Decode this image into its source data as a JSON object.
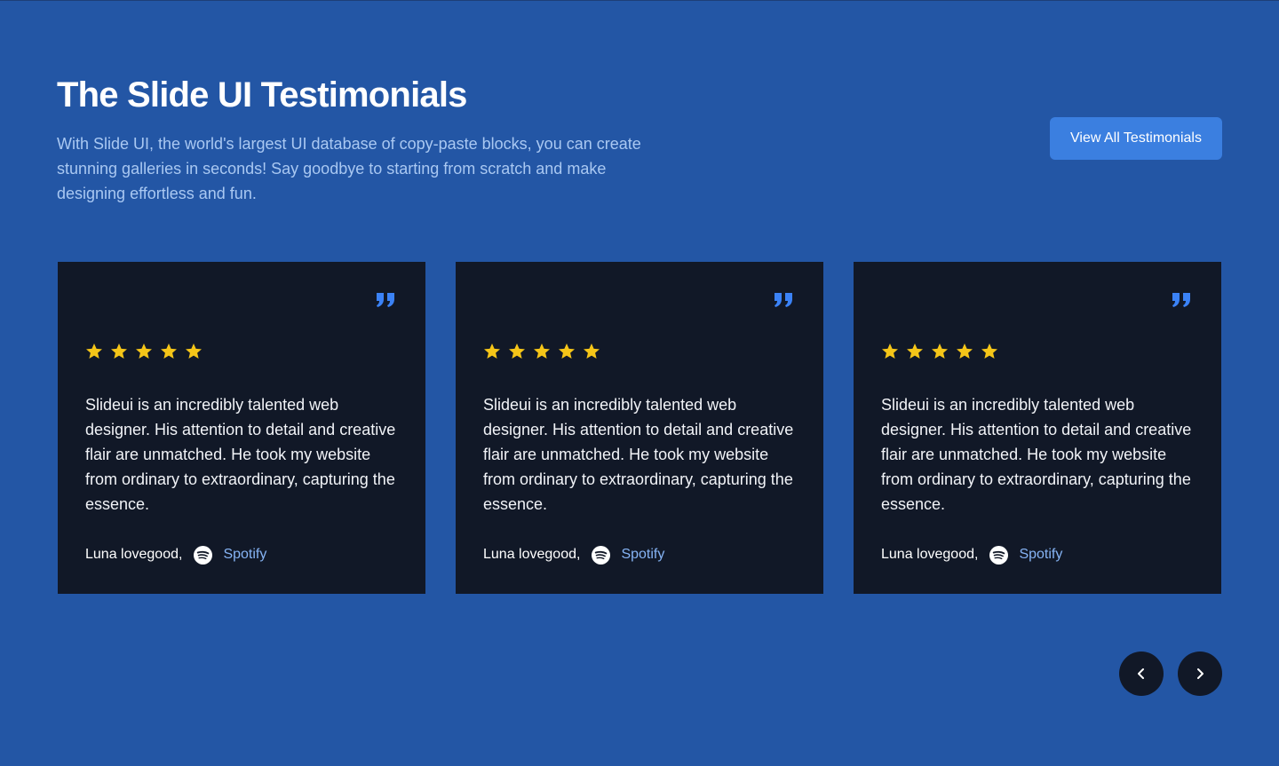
{
  "section": {
    "title": "The Slide UI Testimonials",
    "description": "With Slide UI, the world's largest UI database of copy-paste blocks, you can create stunning galleries in seconds! Say goodbye to starting from scratch and make designing effortless and fun.",
    "view_all_label": "View All Testimonials"
  },
  "testimonials": [
    {
      "rating": 5,
      "text": "Slideui is an incredibly talented web designer. His attention to detail and creative flair are unmatched. He took my website from ordinary to extraordinary, capturing the essence.",
      "author": "Luna lovegood,",
      "company": "Spotify",
      "company_icon": "spotify-icon"
    },
    {
      "rating": 5,
      "text": "Slideui is an incredibly talented web designer. His attention to detail and creative flair are unmatched. He took my website from ordinary to extraordinary, capturing the essence.",
      "author": "Luna lovegood,",
      "company": "Spotify",
      "company_icon": "spotify-icon"
    },
    {
      "rating": 5,
      "text": "Slideui is an incredibly talented web designer. His attention to detail and creative flair are unmatched. He took my website from ordinary to extraordinary, capturing the essence.",
      "author": "Luna lovegood,",
      "company": "Spotify",
      "company_icon": "spotify-icon"
    }
  ],
  "navigation": {
    "prev_icon": "chevron-left-icon",
    "next_icon": "chevron-right-icon"
  },
  "colors": {
    "background": "#2356a5",
    "card_background": "#111827",
    "accent": "#3b7fe0",
    "star": "#f5c518",
    "quote": "#3b82f6",
    "company_link": "#86b4f5"
  }
}
